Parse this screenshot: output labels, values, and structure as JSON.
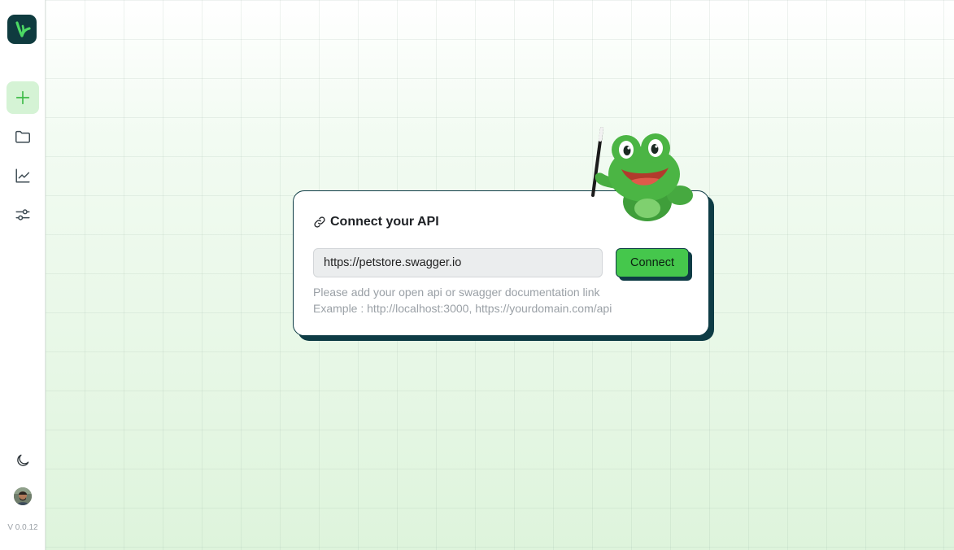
{
  "sidebar": {
    "logo_icon": "leaf-logo-icon",
    "nav": [
      {
        "name": "new",
        "icon": "plus-icon",
        "active": true
      },
      {
        "name": "projects",
        "icon": "folder-icon",
        "active": false
      },
      {
        "name": "analytics",
        "icon": "chart-line-icon",
        "active": false
      },
      {
        "name": "settings",
        "icon": "sliders-icon",
        "active": false
      }
    ],
    "theme_icon": "moon-icon",
    "version": "V 0.0.12"
  },
  "connect_card": {
    "title": "Connect your API",
    "input_value": "https://petstore.swagger.io",
    "button_label": "Connect",
    "hint_line1": "Please add your open api or swagger documentation link",
    "hint_line2": "Example : http://localhost:3000, https://yourdomain.com/api"
  },
  "colors": {
    "accent": "#45c74c",
    "dark": "#0e3c45",
    "active_nav_bg": "#d5f3d5"
  }
}
